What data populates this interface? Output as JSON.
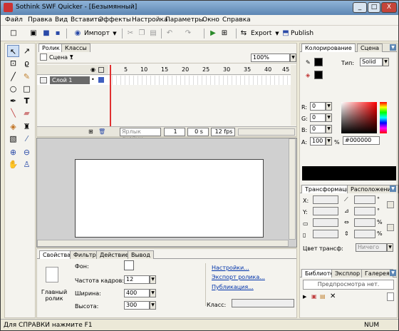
{
  "window": {
    "title": "Sothink SWF Quicker - [Безымянный]",
    "minimize": "_",
    "maximize": "□",
    "close": "X"
  },
  "menu": [
    "Файл",
    "Правка",
    "Вид",
    "Вставить",
    "Эффекты",
    "Настройка",
    "Параметры",
    "Окно",
    "Справка"
  ],
  "toolbar": {
    "import_label": "Импорт",
    "export_label": "Export",
    "publish_label": "Publish"
  },
  "timeline": {
    "tabs": [
      "Ролик",
      "Классы"
    ],
    "scene": "Сцена 1",
    "zoom": "100%",
    "layer": "Слой 1",
    "frame_marks": [
      "5",
      "10",
      "15",
      "20",
      "25",
      "30",
      "35",
      "40",
      "45"
    ],
    "frame_label_placeholder": "Ярлык ячейки",
    "current_frame": "1",
    "time": "0 s",
    "fps": "12 fps"
  },
  "props": {
    "tabs": [
      "Свойства",
      "Фильтр",
      "Действие",
      "Вывод"
    ],
    "object_name": "Главный ролик",
    "bg_label": "Фон:",
    "fps_label": "Частота кадров:",
    "fps_value": "12",
    "width_label": "Ширина:",
    "width_value": "400",
    "height_label": "Высота:",
    "height_value": "300",
    "link_settings": "Настройки...",
    "link_export": "Экспорт ролика...",
    "link_publish": "Публикация...",
    "class_label": "Класс:"
  },
  "color_panel": {
    "tabs": [
      "Колорирование",
      "Сцена"
    ],
    "type_label": "Тип:",
    "type_value": "Solid",
    "r_label": "R:",
    "r_value": "0",
    "g_label": "G:",
    "g_value": "0",
    "b_label": "B:",
    "b_value": "0",
    "a_label": "A:",
    "a_value": "100",
    "a_unit": "%",
    "hex_value": "#000000"
  },
  "transform_panel": {
    "tabs": [
      "Трансформации",
      "Расположение"
    ],
    "x_label": "X:",
    "y_label": "Y:",
    "deg": "°",
    "pct": "%",
    "color_transform_label": "Цвет трансф:",
    "color_transform_value": "Ничего"
  },
  "library_panel": {
    "tabs": [
      "Библиоте",
      "Эксплор",
      "Галерея"
    ],
    "preview_text": "Предпросмотра нет."
  },
  "status": {
    "help": "Для СПРАВКИ нажмите F1",
    "num": "NUM"
  },
  "colors": {
    "title_bar": "#6f96c2",
    "panel_bg": "#f4f3ee",
    "stage_bg": "#d0d0d0",
    "link": "#0033aa",
    "playhead": "#e03030"
  }
}
